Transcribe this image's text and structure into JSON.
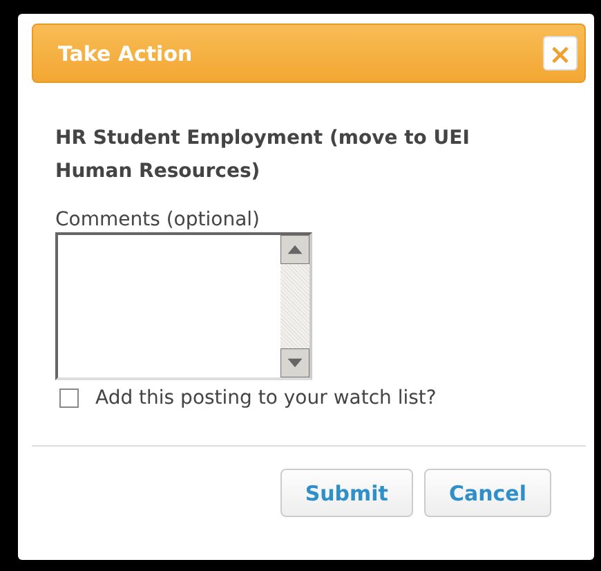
{
  "dialog": {
    "title": "Take Action",
    "close": "×"
  },
  "heading": "HR Student Employment (move to UEI Human Resources)",
  "comments": {
    "label": "Comments (optional)"
  },
  "watch": {
    "label": "Add this posting to your watch list?",
    "checked": false
  },
  "buttons": [
    {
      "label": "Submit"
    },
    {
      "label": "Cancel"
    }
  ]
}
